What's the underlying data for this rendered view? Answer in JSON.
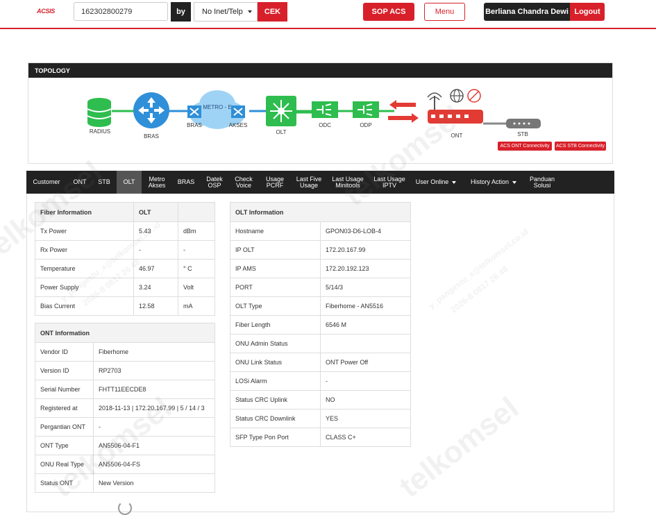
{
  "header": {
    "logo": "ACSIS",
    "search_value": "162302800279",
    "by_label": "by",
    "search_type": "No Inet/Telp",
    "cek_label": "CEK",
    "sop_label": "SOP ACS",
    "menu_label": "Menu",
    "user_name": "Berliana Chandra Dewi",
    "logout_label": "Logout"
  },
  "topology": {
    "title": "TOPOLOGY",
    "nodes": {
      "radius": "RADIUS",
      "bras": "BRAS",
      "bras_metro": "BRAS",
      "metro_cloud": "METRO - E",
      "akses": "AKSES",
      "olt": "OLT",
      "odc": "ODC",
      "odp": "ODP",
      "ont": "ONT",
      "stb": "STB"
    },
    "acs_ont_btn": "ACS ONT Connectivity",
    "acs_stb_btn": "ACS STB Connectivity"
  },
  "nav": {
    "items": [
      {
        "label": "Customer"
      },
      {
        "label": "ONT"
      },
      {
        "label": "STB"
      },
      {
        "label": "OLT"
      },
      {
        "label1": "Metro",
        "label2": "Akses"
      },
      {
        "label": "BRAS"
      },
      {
        "label1": "Datek",
        "label2": "OSP"
      },
      {
        "label1": "Check",
        "label2": "Voice"
      },
      {
        "label1": "Usage",
        "label2": "PCRF"
      },
      {
        "label1": "Last Five",
        "label2": "Usage"
      },
      {
        "label1": "Last Usage",
        "label2": "Minitools"
      },
      {
        "label1": "Last Usage",
        "label2": "IPTV"
      },
      {
        "label": "User Online"
      },
      {
        "label": "History Action"
      },
      {
        "label1": "Panduan",
        "label2": "Solusi"
      }
    ],
    "active": "OLT"
  },
  "fiber": {
    "header": [
      "Fiber Information",
      "OLT",
      ""
    ],
    "rows": [
      [
        "Tx Power",
        "5.43",
        "dBm"
      ],
      [
        "Rx Power",
        "-",
        "-"
      ],
      [
        "Temperature",
        "46.97",
        "° C"
      ],
      [
        "Power Supply",
        "3.24",
        "Volt"
      ],
      [
        "Bias Current",
        "12.58",
        "mA"
      ]
    ]
  },
  "ont_info": {
    "header": "ONT Information",
    "rows": [
      [
        "Vendor ID",
        "Fiberhome"
      ],
      [
        "Version ID",
        "RP2703"
      ],
      [
        "Serial Number",
        "FHTT11EECDE8"
      ],
      [
        "Registered at",
        "2018-11-13 | 172.20.167.99 | 5 / 14 / 3"
      ],
      [
        "Pergantian ONT",
        "-"
      ],
      [
        "ONT Type",
        "AN5506-04-F1"
      ],
      [
        "ONU Real Type",
        "AN5506-04-FS"
      ],
      [
        "Status ONT",
        "New Version"
      ]
    ]
  },
  "olt_info": {
    "header": "OLT Information",
    "rows": [
      [
        "Hostname",
        "GPON03-D6-LOB-4"
      ],
      [
        "IP OLT",
        "172.20.167.99"
      ],
      [
        "IP AMS",
        "172.20.192.123"
      ],
      [
        "PORT",
        "5/14/3"
      ],
      [
        "OLT Type",
        "Fiberhome - AN5516"
      ],
      [
        "Fiber Length",
        "6546 M"
      ],
      [
        "ONU Admin Status",
        ""
      ],
      [
        "ONU Link Status",
        "ONT Power Off"
      ],
      [
        "LOSi Alarm",
        "-"
      ],
      [
        "Status CRC Uplink",
        "NO"
      ],
      [
        "Status CRC Downlink",
        "YES"
      ],
      [
        "SFP Type Pon Port",
        "CLASS C+"
      ]
    ]
  },
  "watermark": {
    "brand": "telkomsel",
    "user_line1": "y_pangestu_x@telkomsel.co.id",
    "user_line2": "2026-8 0817 26 48"
  },
  "colors": {
    "brand_red": "#d8202a",
    "dark": "#222222",
    "green": "#2ebd4e",
    "blue": "#2f8fd8"
  }
}
